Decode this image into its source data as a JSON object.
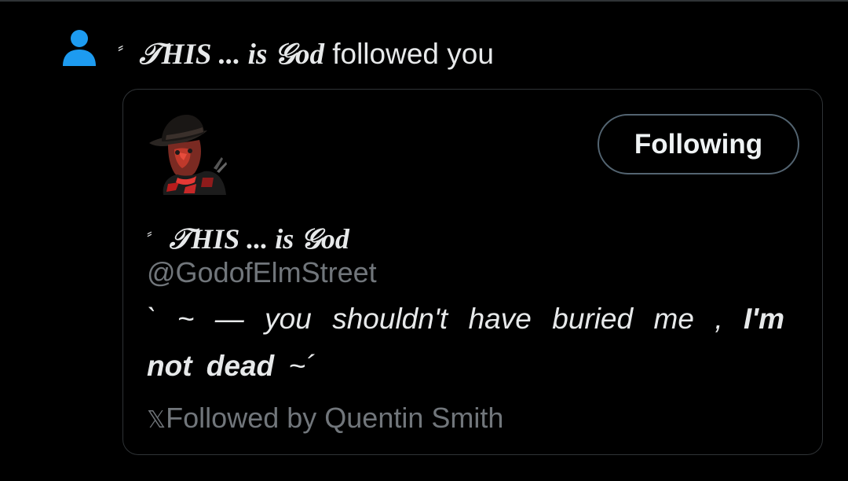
{
  "notification": {
    "deco": "⸗",
    "name": "𝒯HIS ... is 𝒢od",
    "action": " followed you"
  },
  "card": {
    "follow_button_label": "Following",
    "deco": "⸗",
    "display_name": "𝒯HIS ... is 𝒢od",
    "handle": "@GodofElmStreet",
    "bio_part1": "` ~ — you shouldn't have buried me , ",
    "bio_bold": "I'm not dead",
    "bio_part2": " ~´",
    "followed_by_icon": "𝕏",
    "followed_by_text": "Followed by Quentin Smith"
  },
  "colors": {
    "background": "#000000",
    "notification_icon": "#1d9bf0",
    "primary_text": "#e7e9ea",
    "secondary_text": "#71767b",
    "border": "#2f3336"
  },
  "icons": {
    "notification": "person-icon",
    "avatar": "freddy-krueger-avatar"
  }
}
